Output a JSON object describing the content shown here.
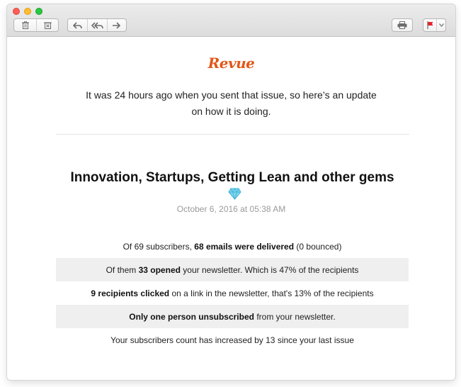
{
  "toolbar": {
    "icons": [
      "trash-icon",
      "junk-icon",
      "reply-icon",
      "reply-all-icon",
      "forward-icon",
      "print-icon",
      "flag-icon",
      "chevron-down-icon"
    ]
  },
  "email": {
    "logo": "Revue",
    "intro": "It was 24 hours ago when you sent that issue, so here’s an update on how it is doing.",
    "issue_title": "Innovation, Startups, Getting Lean and other gems",
    "issue_date": "October 6, 2016 at 05:38 AM",
    "stats": {
      "row1": {
        "before": "Of 69 subscribers, ",
        "bold": "68 emails were delivered",
        "after": " (0 bounced)"
      },
      "row2": {
        "before": "Of them ",
        "bold": "33 opened",
        "after": " your newsletter. Which is 47% of the recipients"
      },
      "row3": {
        "before": "",
        "bold": "9 recipients clicked",
        "after": " on a link in the newsletter, that's 13% of the recipients"
      },
      "row4": {
        "before": "",
        "bold": "Only one person unsubscribed",
        "after": " from your newsletter."
      },
      "row5": {
        "text": "Your subscribers count has increased by 13 since your last issue"
      }
    }
  },
  "colors": {
    "brand": "#e15718",
    "row_alt_bg": "#efefef",
    "date_gray": "#9a9a9a",
    "flag_red": "#e8212b"
  }
}
